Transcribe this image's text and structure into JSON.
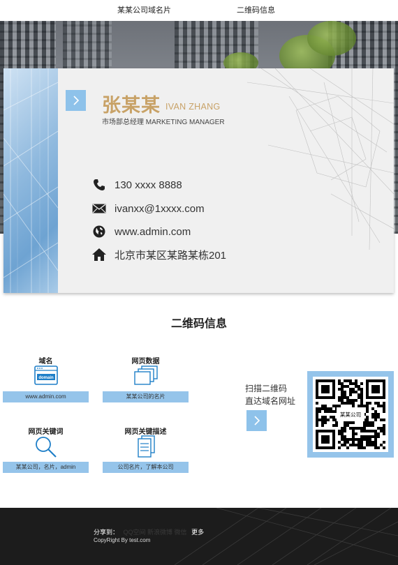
{
  "nav": {
    "items": [
      "某某公司域名片",
      "二维码信息"
    ]
  },
  "card": {
    "cn_name": "张某某",
    "en_name": "IVAN ZHANG",
    "title": "市场部总经理  MARKETING MANAGER",
    "contacts": [
      {
        "icon": "phone-icon",
        "text": "130 xxxx 8888"
      },
      {
        "icon": "mail-icon",
        "text": "ivanxx@1xxxx.com"
      },
      {
        "icon": "globe-icon",
        "text": "www.admin.com"
      },
      {
        "icon": "home-icon",
        "text": "北京市某区某路某栋201"
      }
    ]
  },
  "qr_section": {
    "heading": "二维码信息",
    "features": [
      {
        "name": "域名",
        "icon": "domain-icon",
        "icon_text": "domain",
        "value": "www.admin.com"
      },
      {
        "name": "网页数据",
        "icon": "pages-icon",
        "value": "某某公司的名片"
      },
      {
        "name": "网页关键词",
        "icon": "search-icon",
        "value": "某某公司，名片，admin"
      },
      {
        "name": "网页关键描述",
        "icon": "document-icon",
        "value": "公司名片，了解本公司"
      }
    ],
    "scan_line1": "扫描二维码",
    "scan_line2": "直达域名网址",
    "qr_label": "某某公司"
  },
  "footer": {
    "share_label": "分享到：",
    "share_targets": "QQ空间 新浪微博 微信",
    "more": "更多",
    "copyright": "CopyRight By test.com"
  },
  "colors": {
    "accent_blue": "#8ec2ea",
    "name_gold": "#c8a267",
    "footer_bg": "#1c1c1c"
  }
}
